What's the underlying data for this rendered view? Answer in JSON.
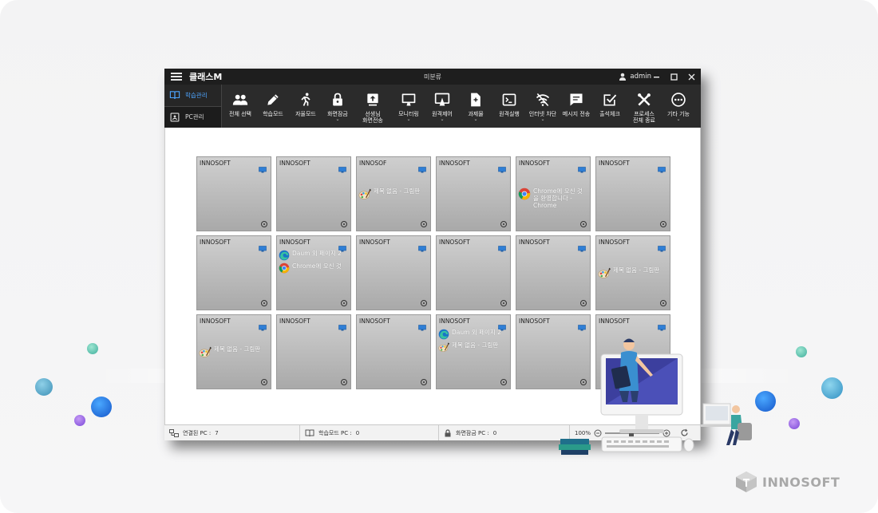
{
  "window": {
    "app_title": "클래스M",
    "center_title": "미분류",
    "user": "admin"
  },
  "left_tabs": [
    {
      "label": "학습관리",
      "icon": "book-icon",
      "active": true
    },
    {
      "label": "PC관리",
      "icon": "pc-card-icon",
      "active": false
    }
  ],
  "toolbar": [
    {
      "label": "전체 선택",
      "icon": "users-icon",
      "dropdown": false
    },
    {
      "label": "학습모드",
      "icon": "pencil-icon",
      "dropdown": false
    },
    {
      "label": "자율모드",
      "icon": "runner-icon",
      "dropdown": false
    },
    {
      "label": "화면잠금",
      "icon": "lock-icon",
      "dropdown": true
    },
    {
      "label": "선생님",
      "label2": "화면전송",
      "icon": "screen-upload-icon",
      "dropdown": false
    },
    {
      "label": "모니터링",
      "icon": "monitor-icon",
      "dropdown": true
    },
    {
      "label": "원격제어",
      "icon": "remote-control-icon",
      "dropdown": true
    },
    {
      "label": "과제물",
      "icon": "document-icon",
      "dropdown": true
    },
    {
      "label": "원격실행",
      "icon": "terminal-icon",
      "dropdown": false
    },
    {
      "label": "인터넷 차단",
      "icon": "wifi-off-icon",
      "dropdown": true
    },
    {
      "label": "메시지 전송",
      "icon": "message-icon",
      "dropdown": false
    },
    {
      "label": "출석체크",
      "icon": "check-icon",
      "dropdown": false
    },
    {
      "label": "프로세스",
      "label2": "전체 종료",
      "icon": "tools-icon",
      "dropdown": false
    },
    {
      "label": "기타 기능",
      "icon": "more-icon",
      "dropdown": true
    }
  ],
  "tiles": [
    {
      "name": "INNOSOFT",
      "procs": []
    },
    {
      "name": "INNOSOFT",
      "procs": []
    },
    {
      "name": "INNOSOF",
      "procs": [
        {
          "icon": "paint-icon",
          "text": "제목 없음 - 그림판"
        }
      ]
    },
    {
      "name": "INNOSOFT",
      "procs": []
    },
    {
      "name": "INNOSOFT",
      "procs": [
        {
          "icon": "chrome-icon",
          "text": "Chrome에 오신 것을 환영합니다 - Chrome"
        }
      ]
    },
    {
      "name": "INNOSOFT",
      "procs": []
    },
    {
      "name": "INNOSOFT",
      "procs": []
    },
    {
      "name": "INNOSOFT",
      "procs": [
        {
          "icon": "edge-icon",
          "text": "Daum 외 페이지 2"
        },
        {
          "icon": "chrome-icon",
          "text": "Chrome에 오신 것"
        }
      ]
    },
    {
      "name": "INNOSOFT",
      "procs": []
    },
    {
      "name": "INNOSOFT",
      "procs": []
    },
    {
      "name": "INNOSOFT",
      "procs": []
    },
    {
      "name": "INNOSOFT",
      "procs": [
        {
          "icon": "paint-icon",
          "text": "제목 없음 - 그림판"
        }
      ]
    },
    {
      "name": "INNOSOFT",
      "procs": [
        {
          "icon": "paint-icon",
          "text": "제목 없음 - 그림판"
        }
      ]
    },
    {
      "name": "INNOSOFT",
      "procs": []
    },
    {
      "name": "INNOSOFT",
      "procs": []
    },
    {
      "name": "INNOSOFT",
      "procs": [
        {
          "icon": "edge-icon",
          "text": "Daum 외 페이지 2"
        },
        {
          "icon": "paint-icon",
          "text": "제목 없음 - 그림판"
        }
      ]
    },
    {
      "name": "INNOSOFT",
      "procs": []
    },
    {
      "name": "INNOSOFT",
      "procs": []
    }
  ],
  "status": {
    "connected_label": "연결된 PC :",
    "connected_count": "7",
    "study_label": "학습모드 PC :",
    "study_count": "0",
    "lock_label": "화면잠금 PC :",
    "lock_count": "0",
    "zoom": "100%"
  },
  "brand": {
    "name": "INNOSOFT"
  },
  "colors": {
    "titlebar": "#1e1e1e",
    "ribbon": "#2b2b2b",
    "active_tab": "#4ea5ff",
    "tile_top": "#cfcfcf",
    "tile_bottom": "#a9a9a9",
    "monitor_icon": "#2f7fd6"
  }
}
